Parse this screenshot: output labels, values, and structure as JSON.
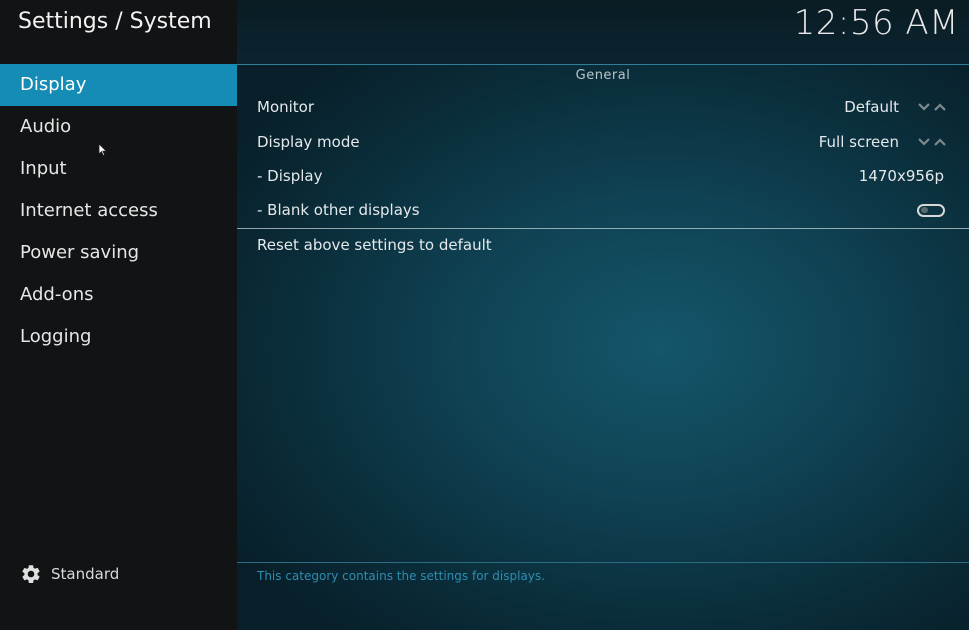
{
  "header": {
    "title": "Settings / System",
    "clock": "12:56 AM"
  },
  "sidebar": {
    "items": [
      {
        "label": "Display",
        "active": true
      },
      {
        "label": "Audio",
        "active": false
      },
      {
        "label": "Input",
        "active": false
      },
      {
        "label": "Internet access",
        "active": false
      },
      {
        "label": "Power saving",
        "active": false
      },
      {
        "label": "Add-ons",
        "active": false
      },
      {
        "label": "Logging",
        "active": false
      }
    ],
    "settings_level": {
      "icon": "gear-icon",
      "label": "Standard"
    }
  },
  "main": {
    "group_title": "General",
    "settings": {
      "monitor": {
        "label": "Monitor",
        "value": "Default"
      },
      "display_mode": {
        "label": "Display mode",
        "value": "Full screen"
      },
      "display": {
        "label": "- Display",
        "value": "1470x956p"
      },
      "blank_other": {
        "label": "- Blank other displays",
        "enabled": false
      }
    },
    "reset_label": "Reset above settings to default",
    "description": "This category contains the settings for displays."
  },
  "colors": {
    "accent": "#148cb6",
    "sidebar_bg": "#111315",
    "main_bg": "#0f4253",
    "description_text": "#2f8db0"
  }
}
